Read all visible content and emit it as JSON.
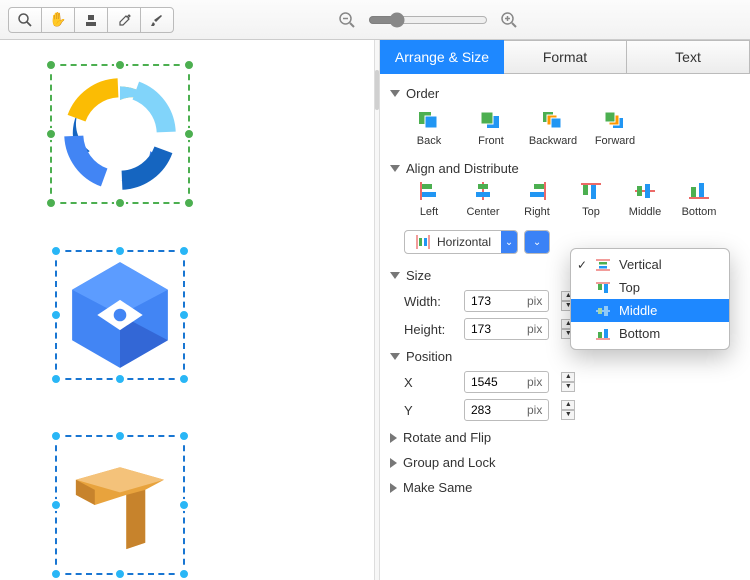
{
  "tabs": {
    "arrange": "Arrange & Size",
    "format": "Format",
    "text": "Text"
  },
  "sections": {
    "order": "Order",
    "align": "Align and Distribute",
    "size": "Size",
    "position": "Position",
    "rotate": "Rotate and Flip",
    "group": "Group and Lock",
    "makesame": "Make Same"
  },
  "order": {
    "back": "Back",
    "front": "Front",
    "backward": "Backward",
    "forward": "Forward"
  },
  "align": {
    "left": "Left",
    "center": "Center",
    "right": "Right",
    "top": "Top",
    "middle": "Middle",
    "bottom": "Bottom"
  },
  "distribute": {
    "horizontal": "Horizontal"
  },
  "dropdown": {
    "vertical": "Vertical",
    "top": "Top",
    "middle": "Middle",
    "bottom": "Bottom"
  },
  "size": {
    "widthLabel": "Width:",
    "heightLabel": "Height:",
    "width": "173",
    "height": "173",
    "unit": "pix"
  },
  "position": {
    "xLabel": "X",
    "yLabel": "Y",
    "x": "1545",
    "y": "283",
    "unit": "pix"
  },
  "zoom": {
    "value": "20"
  }
}
